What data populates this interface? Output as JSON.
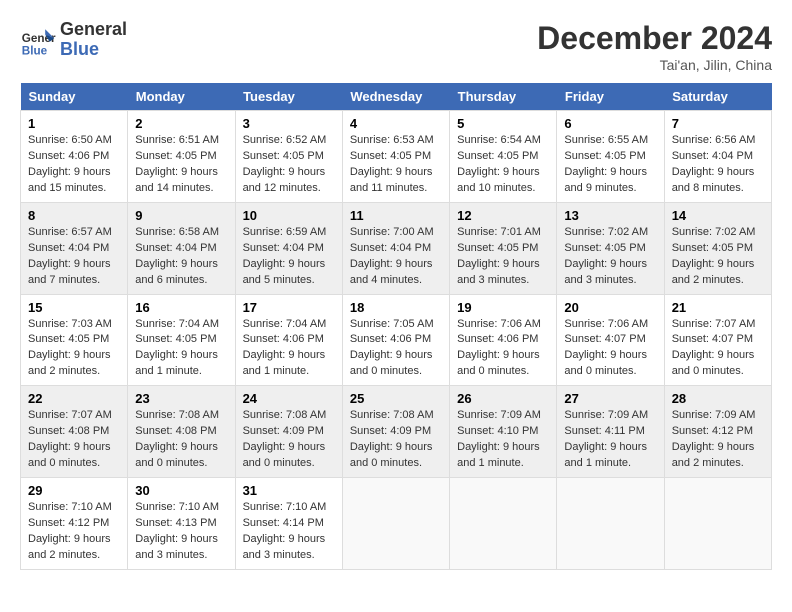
{
  "header": {
    "logo_line1": "General",
    "logo_line2": "Blue",
    "title": "December 2024",
    "subtitle": "Tai'an, Jilin, China"
  },
  "weekdays": [
    "Sunday",
    "Monday",
    "Tuesday",
    "Wednesday",
    "Thursday",
    "Friday",
    "Saturday"
  ],
  "weeks": [
    [
      {
        "day": "1",
        "sunrise": "6:50 AM",
        "sunset": "4:06 PM",
        "daylight": "9 hours and 15 minutes."
      },
      {
        "day": "2",
        "sunrise": "6:51 AM",
        "sunset": "4:05 PM",
        "daylight": "9 hours and 14 minutes."
      },
      {
        "day": "3",
        "sunrise": "6:52 AM",
        "sunset": "4:05 PM",
        "daylight": "9 hours and 12 minutes."
      },
      {
        "day": "4",
        "sunrise": "6:53 AM",
        "sunset": "4:05 PM",
        "daylight": "9 hours and 11 minutes."
      },
      {
        "day": "5",
        "sunrise": "6:54 AM",
        "sunset": "4:05 PM",
        "daylight": "9 hours and 10 minutes."
      },
      {
        "day": "6",
        "sunrise": "6:55 AM",
        "sunset": "4:05 PM",
        "daylight": "9 hours and 9 minutes."
      },
      {
        "day": "7",
        "sunrise": "6:56 AM",
        "sunset": "4:04 PM",
        "daylight": "9 hours and 8 minutes."
      }
    ],
    [
      {
        "day": "8",
        "sunrise": "6:57 AM",
        "sunset": "4:04 PM",
        "daylight": "9 hours and 7 minutes."
      },
      {
        "day": "9",
        "sunrise": "6:58 AM",
        "sunset": "4:04 PM",
        "daylight": "9 hours and 6 minutes."
      },
      {
        "day": "10",
        "sunrise": "6:59 AM",
        "sunset": "4:04 PM",
        "daylight": "9 hours and 5 minutes."
      },
      {
        "day": "11",
        "sunrise": "7:00 AM",
        "sunset": "4:04 PM",
        "daylight": "9 hours and 4 minutes."
      },
      {
        "day": "12",
        "sunrise": "7:01 AM",
        "sunset": "4:05 PM",
        "daylight": "9 hours and 3 minutes."
      },
      {
        "day": "13",
        "sunrise": "7:02 AM",
        "sunset": "4:05 PM",
        "daylight": "9 hours and 3 minutes."
      },
      {
        "day": "14",
        "sunrise": "7:02 AM",
        "sunset": "4:05 PM",
        "daylight": "9 hours and 2 minutes."
      }
    ],
    [
      {
        "day": "15",
        "sunrise": "7:03 AM",
        "sunset": "4:05 PM",
        "daylight": "9 hours and 2 minutes."
      },
      {
        "day": "16",
        "sunrise": "7:04 AM",
        "sunset": "4:05 PM",
        "daylight": "9 hours and 1 minute."
      },
      {
        "day": "17",
        "sunrise": "7:04 AM",
        "sunset": "4:06 PM",
        "daylight": "9 hours and 1 minute."
      },
      {
        "day": "18",
        "sunrise": "7:05 AM",
        "sunset": "4:06 PM",
        "daylight": "9 hours and 0 minutes."
      },
      {
        "day": "19",
        "sunrise": "7:06 AM",
        "sunset": "4:06 PM",
        "daylight": "9 hours and 0 minutes."
      },
      {
        "day": "20",
        "sunrise": "7:06 AM",
        "sunset": "4:07 PM",
        "daylight": "9 hours and 0 minutes."
      },
      {
        "day": "21",
        "sunrise": "7:07 AM",
        "sunset": "4:07 PM",
        "daylight": "9 hours and 0 minutes."
      }
    ],
    [
      {
        "day": "22",
        "sunrise": "7:07 AM",
        "sunset": "4:08 PM",
        "daylight": "9 hours and 0 minutes."
      },
      {
        "day": "23",
        "sunrise": "7:08 AM",
        "sunset": "4:08 PM",
        "daylight": "9 hours and 0 minutes."
      },
      {
        "day": "24",
        "sunrise": "7:08 AM",
        "sunset": "4:09 PM",
        "daylight": "9 hours and 0 minutes."
      },
      {
        "day": "25",
        "sunrise": "7:08 AM",
        "sunset": "4:09 PM",
        "daylight": "9 hours and 0 minutes."
      },
      {
        "day": "26",
        "sunrise": "7:09 AM",
        "sunset": "4:10 PM",
        "daylight": "9 hours and 1 minute."
      },
      {
        "day": "27",
        "sunrise": "7:09 AM",
        "sunset": "4:11 PM",
        "daylight": "9 hours and 1 minute."
      },
      {
        "day": "28",
        "sunrise": "7:09 AM",
        "sunset": "4:12 PM",
        "daylight": "9 hours and 2 minutes."
      }
    ],
    [
      {
        "day": "29",
        "sunrise": "7:10 AM",
        "sunset": "4:12 PM",
        "daylight": "9 hours and 2 minutes."
      },
      {
        "day": "30",
        "sunrise": "7:10 AM",
        "sunset": "4:13 PM",
        "daylight": "9 hours and 3 minutes."
      },
      {
        "day": "31",
        "sunrise": "7:10 AM",
        "sunset": "4:14 PM",
        "daylight": "9 hours and 3 minutes."
      },
      null,
      null,
      null,
      null
    ]
  ]
}
